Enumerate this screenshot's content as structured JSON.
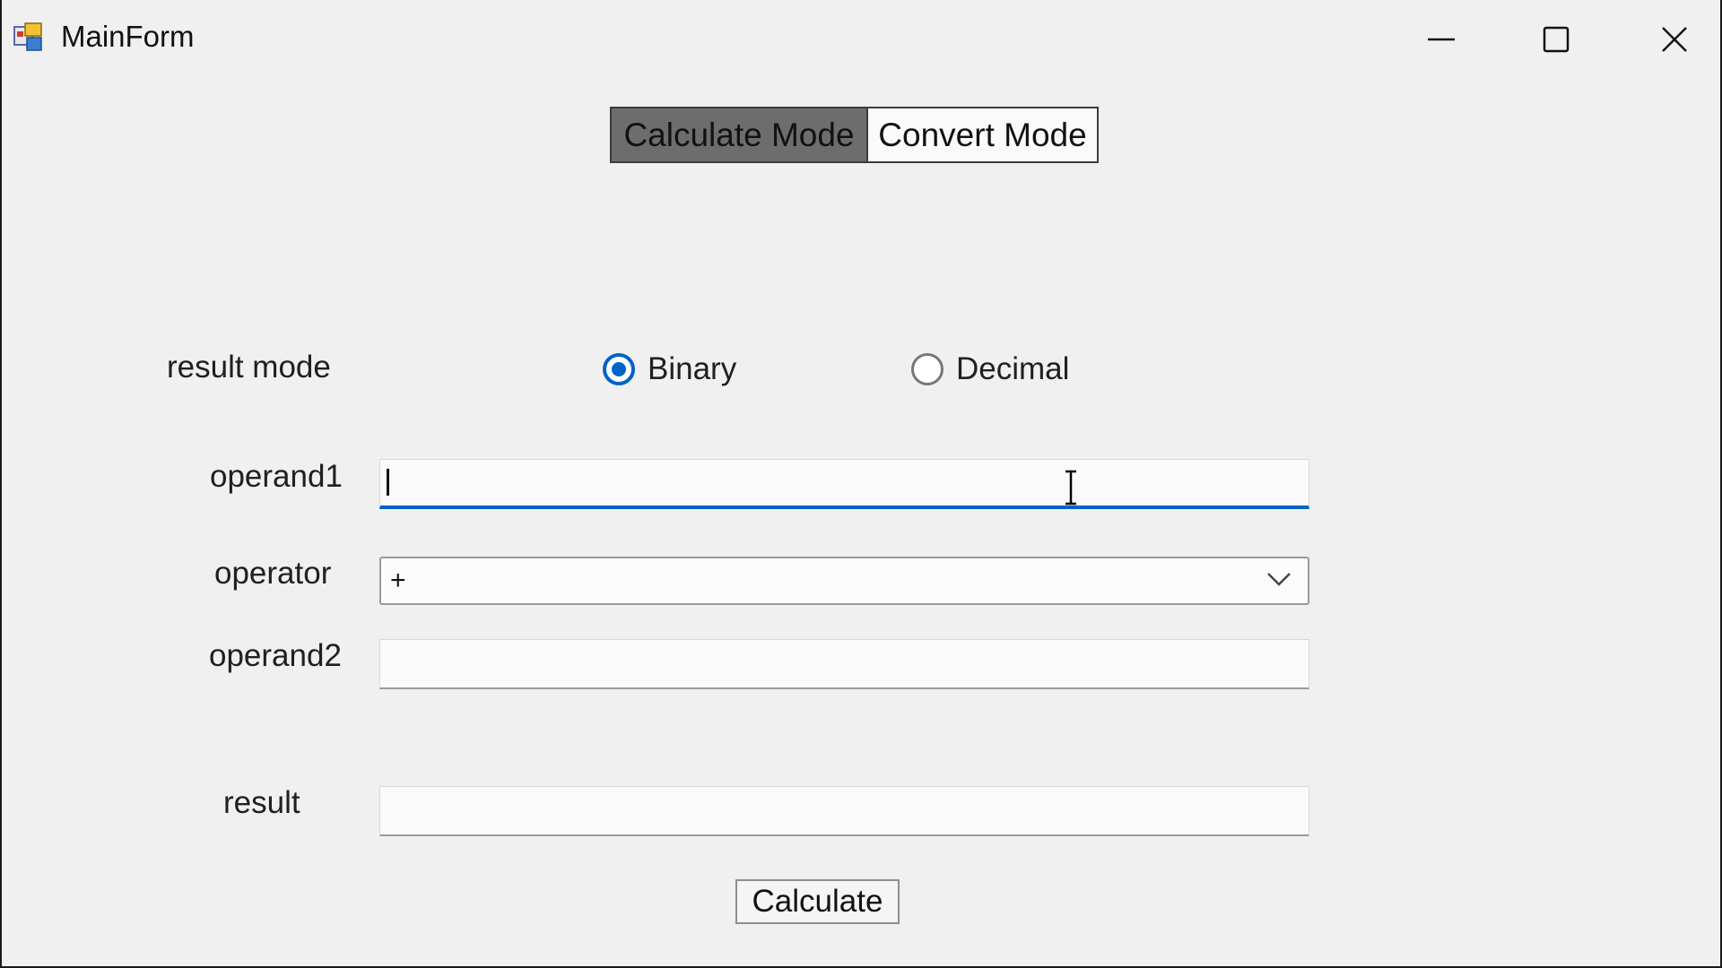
{
  "window": {
    "title": "MainForm",
    "controls": [
      "minimize-icon",
      "maximize-icon",
      "close-icon"
    ]
  },
  "mode_toggle": {
    "calculate_label": "Calculate Mode",
    "convert_label": "Convert Mode",
    "selected": "Calculate Mode"
  },
  "form": {
    "result_mode_label": "result mode",
    "radio_binary": "Binary",
    "radio_decimal": "Decimal",
    "selected_result_mode": "Binary",
    "operand1_label": "operand1",
    "operand1_value": "",
    "operator_label": "operator",
    "operator_value": "+",
    "operand2_label": "operand2",
    "operand2_value": "",
    "result_label": "result",
    "result_value": "",
    "calculate_button": "Calculate"
  },
  "colors": {
    "accent": "#0063c7",
    "active_mode_bg": "#6d6d6d",
    "window_bg": "#f0f0f0"
  }
}
